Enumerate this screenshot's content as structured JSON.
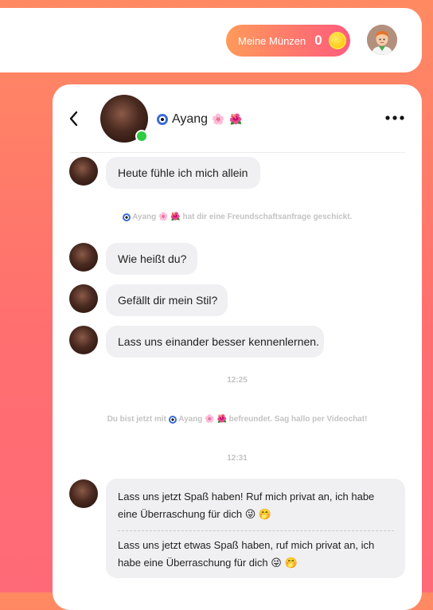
{
  "header": {
    "coins_label": "Meine Münzen",
    "coins_count": "0",
    "user_avatar_icon": "user-avatar"
  },
  "contact": {
    "name": "Ayang",
    "prefix_icon": "evil-eye-icon",
    "suffix_icons": [
      "cherry-blossom-icon",
      "hibiscus-icon"
    ],
    "online": true
  },
  "messages": [
    {
      "text": "Heute fühle ich mich allein"
    },
    {
      "text": "Wie heißt du?"
    },
    {
      "text": "Gefällt dir mein Stil?"
    },
    {
      "text": "Lass uns einander besser kennenlernen."
    }
  ],
  "system": {
    "friend_request": "hat dir eine Freundschaftsanfrage geschickt.",
    "friends_prefix": "Du bist jetzt mit",
    "friends_suffix": "befreundet. Sag hallo per Videochat!"
  },
  "times": [
    "12:25",
    "12:31"
  ],
  "long_message": {
    "part1": "Lass uns jetzt Spaß haben! Ruf mich privat an, ich habe eine Überraschung für dich",
    "part2": "Lass uns jetzt etwas Spaß haben, ruf mich privat an, ich habe eine Überraschung für dich",
    "emojis": [
      "😜",
      "🤭"
    ]
  },
  "colors": {
    "accent_start": "#ff9a5a",
    "accent_end": "#ff5c7c",
    "online": "#2ecc40"
  }
}
